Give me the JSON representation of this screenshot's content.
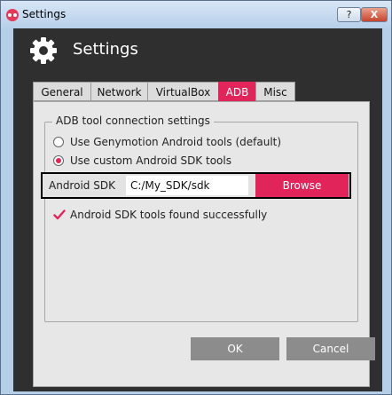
{
  "window": {
    "title": "Settings",
    "help_label": "?",
    "close_label": "X"
  },
  "header": {
    "title": "Settings"
  },
  "tabs": [
    {
      "label": "General"
    },
    {
      "label": "Network"
    },
    {
      "label": "VirtualBox"
    },
    {
      "label": "ADB"
    },
    {
      "label": "Misc"
    }
  ],
  "active_tab": "ADB",
  "adb": {
    "group_title": "ADB tool connection settings",
    "option_genymotion": "Use Genymotion Android tools (default)",
    "option_custom": "Use custom Android SDK tools",
    "selected_option": "custom",
    "sdk_label": "Android SDK",
    "sdk_path": "C:/My_SDK/sdk",
    "browse_label": "Browse",
    "status_text": "Android SDK tools found successfully"
  },
  "footer": {
    "ok_label": "OK",
    "cancel_label": "Cancel"
  },
  "colors": {
    "accent": "#e1245a",
    "dark": "#2f2f2f",
    "button_gray": "#8c8c8c"
  }
}
